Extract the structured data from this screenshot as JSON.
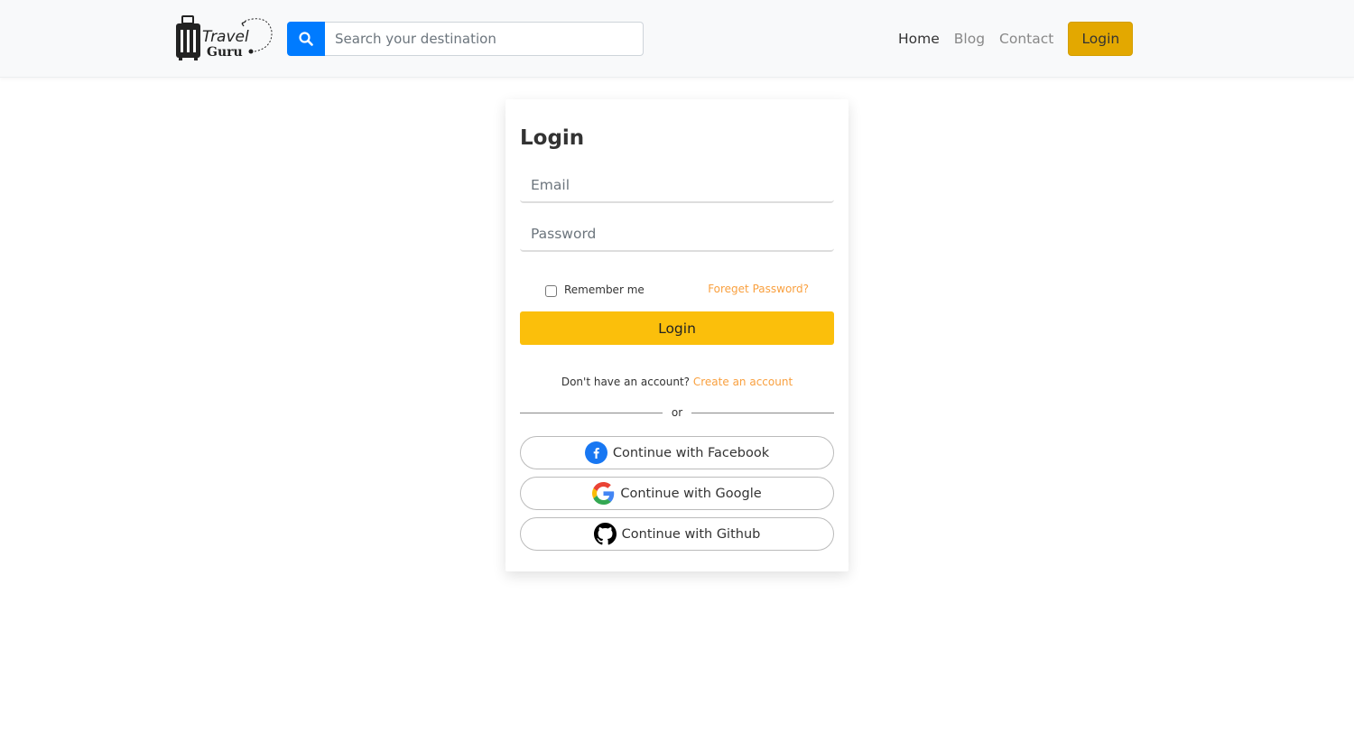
{
  "navbar": {
    "logo": {
      "line1": "Travel",
      "line2": "Guru"
    },
    "search": {
      "placeholder": "Search your destination",
      "value": "",
      "icon": "search-icon"
    },
    "links": [
      {
        "label": "Home",
        "active": true
      },
      {
        "label": "Blog",
        "active": false
      },
      {
        "label": "Contact",
        "active": false
      }
    ],
    "login_label": "Login"
  },
  "login_card": {
    "title": "Login",
    "email": {
      "placeholder": "Email",
      "value": ""
    },
    "password": {
      "placeholder": "Password",
      "value": ""
    },
    "remember_me": {
      "label": "Remember me",
      "checked": false
    },
    "forgot_password": "Foreget Password?",
    "submit_label": "Login",
    "signup_prompt": "Don't have an account?",
    "signup_link": "Create an account",
    "divider_text": "or",
    "social": [
      {
        "label": "Continue with Facebook",
        "icon": "facebook-icon"
      },
      {
        "label": "Continue with Google",
        "icon": "google-icon"
      },
      {
        "label": "Continue with Github",
        "icon": "github-icon"
      }
    ]
  },
  "colors": {
    "accent": "#fbbf0b",
    "nav_login": "#e3a800",
    "link": "#f9a03f",
    "search_button": "#007bff",
    "facebook": "#1877f2"
  }
}
